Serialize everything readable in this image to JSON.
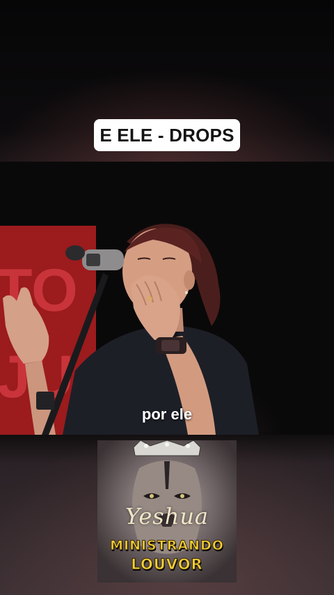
{
  "title": "E ELE - DROPS",
  "video": {
    "banner_letters": [
      "TO",
      "JU"
    ],
    "caption": "por ele"
  },
  "cover": {
    "script_text": "Yeshua",
    "line1": "MINISTRANDO",
    "line2": "LOUVOR"
  },
  "colors": {
    "banner_red": "#9c1b1d",
    "cover_yellow": "#f4d03a"
  }
}
